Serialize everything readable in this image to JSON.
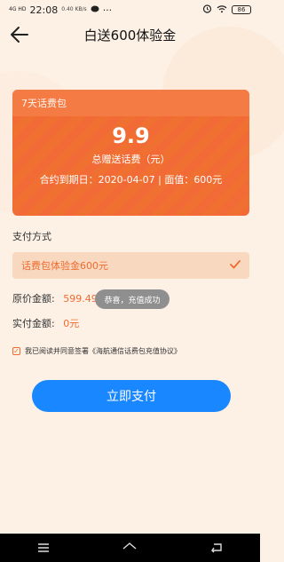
{
  "status_bar": {
    "network_tag": "4G HD",
    "time": "22:08",
    "speed": "0.40 KB/s",
    "dots": "···",
    "battery": "86"
  },
  "header": {
    "title": "白送600体验金"
  },
  "package_card": {
    "tag": "7天话费包",
    "price": "9.9",
    "subtitle": "总赠送话费（元）",
    "expiry": "合约到期日：2020-04-07 | 面值：600元"
  },
  "payment": {
    "section_title": "支付方式",
    "selected_option": "话费包体验金600元"
  },
  "amounts": {
    "original_label": "原价金额:",
    "original_value": "599.49元",
    "actual_label": "实付金额:",
    "actual_value": "0元"
  },
  "toast": {
    "text": "恭喜，充值成功"
  },
  "agreement": {
    "text": "我已阅读并同意签署《海航通信话费包充值协议》"
  },
  "actions": {
    "pay_label": "立即支付"
  },
  "colors": {
    "accent": "#f16a2f",
    "button": "#1987ff",
    "background": "#fdf1e6"
  }
}
